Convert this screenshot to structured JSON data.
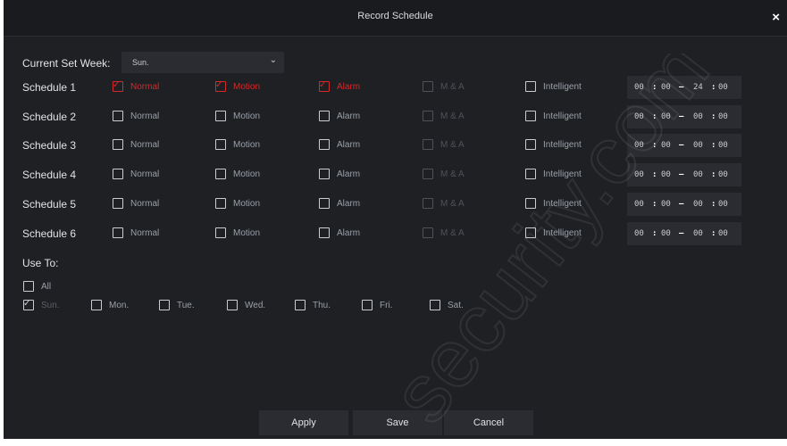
{
  "dialog": {
    "title": "Record Schedule",
    "close_label": "×"
  },
  "week": {
    "label": "Current Set Week:",
    "value": "Sun."
  },
  "columns": [
    "Normal",
    "Motion",
    "Alarm",
    "M & A",
    "Intelligent"
  ],
  "schedules": [
    {
      "label": "Schedule 1",
      "checked": [
        true,
        true,
        true,
        false,
        false
      ],
      "start_h": "00",
      "start_m": "00",
      "end_h": "24",
      "end_m": "00"
    },
    {
      "label": "Schedule 2",
      "checked": [
        false,
        false,
        false,
        false,
        false
      ],
      "start_h": "00",
      "start_m": "00",
      "end_h": "00",
      "end_m": "00"
    },
    {
      "label": "Schedule 3",
      "checked": [
        false,
        false,
        false,
        false,
        false
      ],
      "start_h": "00",
      "start_m": "00",
      "end_h": "00",
      "end_m": "00"
    },
    {
      "label": "Schedule 4",
      "checked": [
        false,
        false,
        false,
        false,
        false
      ],
      "start_h": "00",
      "start_m": "00",
      "end_h": "00",
      "end_m": "00"
    },
    {
      "label": "Schedule 5",
      "checked": [
        false,
        false,
        false,
        false,
        false
      ],
      "start_h": "00",
      "start_m": "00",
      "end_h": "00",
      "end_m": "00"
    },
    {
      "label": "Schedule 6",
      "checked": [
        false,
        false,
        false,
        false,
        false
      ],
      "start_h": "00",
      "start_m": "00",
      "end_h": "00",
      "end_m": "00"
    }
  ],
  "time_separators": {
    "colon": ":",
    "dash": "–"
  },
  "use_to": {
    "label": "Use To:",
    "all_label": "All",
    "days": [
      {
        "label": "Sun.",
        "checked": true,
        "disabled": true
      },
      {
        "label": "Mon.",
        "checked": false,
        "disabled": false
      },
      {
        "label": "Tue.",
        "checked": false,
        "disabled": false
      },
      {
        "label": "Wed.",
        "checked": false,
        "disabled": false
      },
      {
        "label": "Thu.",
        "checked": false,
        "disabled": false
      },
      {
        "label": "Fri.",
        "checked": false,
        "disabled": false
      },
      {
        "label": "Sat.",
        "checked": false,
        "disabled": false
      }
    ]
  },
  "buttons": {
    "apply": "Apply",
    "save": "Save",
    "cancel": "Cancel"
  },
  "icons": {
    "close": "close-icon",
    "dropdown": "chevron-down-icon",
    "check": "checkmark-icon"
  },
  "watermark": "security.com",
  "colors": {
    "active": "#d22a2a",
    "background": "#1e2024",
    "field": "#2a2c31"
  }
}
